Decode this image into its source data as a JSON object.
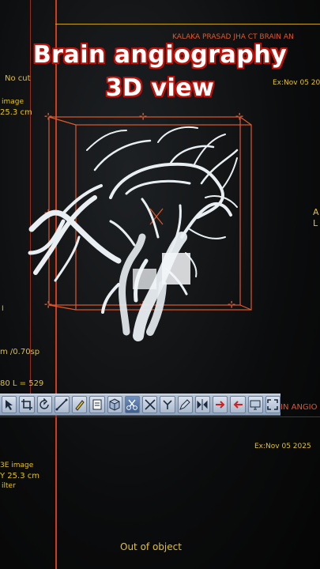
{
  "caption": {
    "line1": "Brain angiography",
    "line2": "3D view"
  },
  "upper_view": {
    "patient_info": "KALAKA PRASAD JHA CT BRAIN AN",
    "exam_date": "Ex:Nov 05 20",
    "cut_status": "No cut",
    "image_label": "image",
    "fov": "25.3 cm",
    "slice_info": "m /0.70sp",
    "window": "80 L = 529",
    "side_marker": "A\nL",
    "left_marker": "I"
  },
  "toolbar": {
    "buttons": [
      "pointer",
      "crop",
      "rotate",
      "measure",
      "annotate",
      "page",
      "3d",
      "cut",
      "trim",
      "segment",
      "edit",
      "flip",
      "arrow-right",
      "arrow-left",
      "screen",
      "fit"
    ]
  },
  "lower_view": {
    "series_title": "IN ANGIO",
    "exam_date": "Ex:Nov 05 2025",
    "image_label": "3E image",
    "fov": "Y 25.3 cm",
    "filter": "ilter",
    "status": "Out of object"
  },
  "colors": {
    "overlay": "#e6c21c",
    "frame": "#e0582a",
    "caption_outline": "#c0120a"
  }
}
